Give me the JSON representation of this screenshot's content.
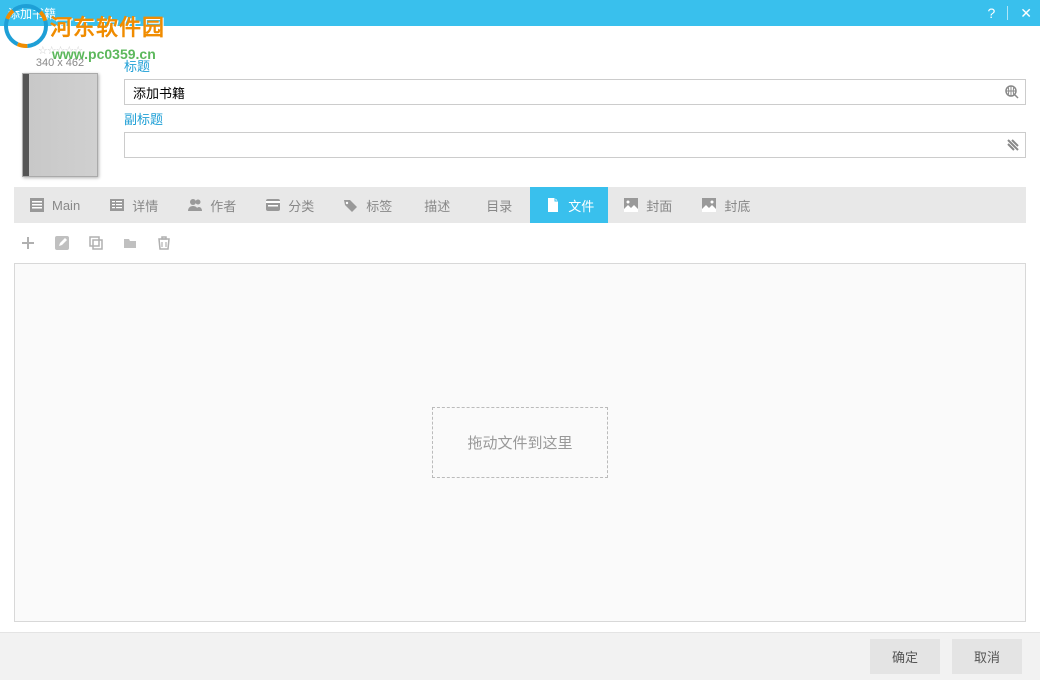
{
  "window": {
    "title": "添加书籍"
  },
  "watermark": {
    "line1": "河东软件园",
    "line2": "www.pc0359.cn"
  },
  "cover": {
    "dimensions": "340 x  462"
  },
  "fields": {
    "title_label": "标题",
    "title_value": "添加书籍",
    "subtitle_label": "副标题",
    "subtitle_value": ""
  },
  "tabs": [
    {
      "id": "main",
      "label": "Main"
    },
    {
      "id": "details",
      "label": "详情"
    },
    {
      "id": "author",
      "label": "作者"
    },
    {
      "id": "category",
      "label": "分类"
    },
    {
      "id": "tags",
      "label": "标签"
    },
    {
      "id": "description",
      "label": "描述"
    },
    {
      "id": "toc",
      "label": "目录"
    },
    {
      "id": "files",
      "label": "文件"
    },
    {
      "id": "front-cover",
      "label": "封面"
    },
    {
      "id": "back-cover",
      "label": "封底"
    }
  ],
  "dropzone": {
    "text": "拖动文件到这里"
  },
  "footer": {
    "ok": "确定",
    "cancel": "取消"
  }
}
